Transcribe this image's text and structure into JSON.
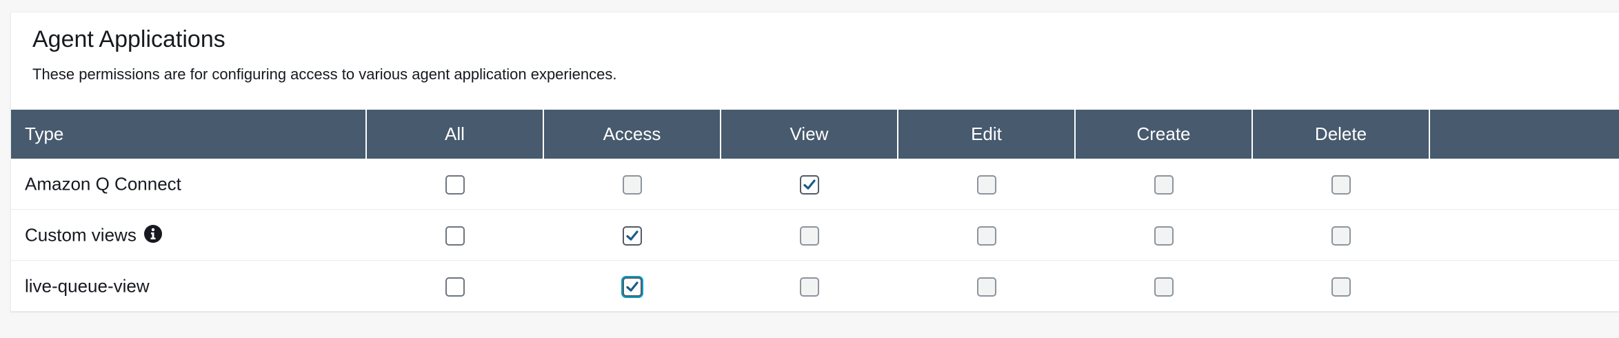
{
  "section": {
    "title": "Agent Applications",
    "description": "These permissions are for configuring access to various agent application experiences."
  },
  "columns": [
    "Type",
    "All",
    "Access",
    "View",
    "Edit",
    "Create",
    "Delete"
  ],
  "rows": [
    {
      "label": "Amazon Q Connect",
      "info_icon": false,
      "all": false,
      "access": false,
      "view": true,
      "edit": false,
      "create": false,
      "delete": false
    },
    {
      "label": "Custom views",
      "info_icon": true,
      "all": false,
      "access": true,
      "view": false,
      "edit": false,
      "create": false,
      "delete": false
    },
    {
      "label": "live-queue-view",
      "info_icon": false,
      "all": false,
      "access": true,
      "view": false,
      "edit": false,
      "create": false,
      "delete": false
    }
  ],
  "icons": {
    "info": "info-circle-icon",
    "check": "checkmark-icon"
  },
  "colors": {
    "header_bg": "#475a6e",
    "check": "#1a5c87",
    "focus": "#00a1c9"
  }
}
